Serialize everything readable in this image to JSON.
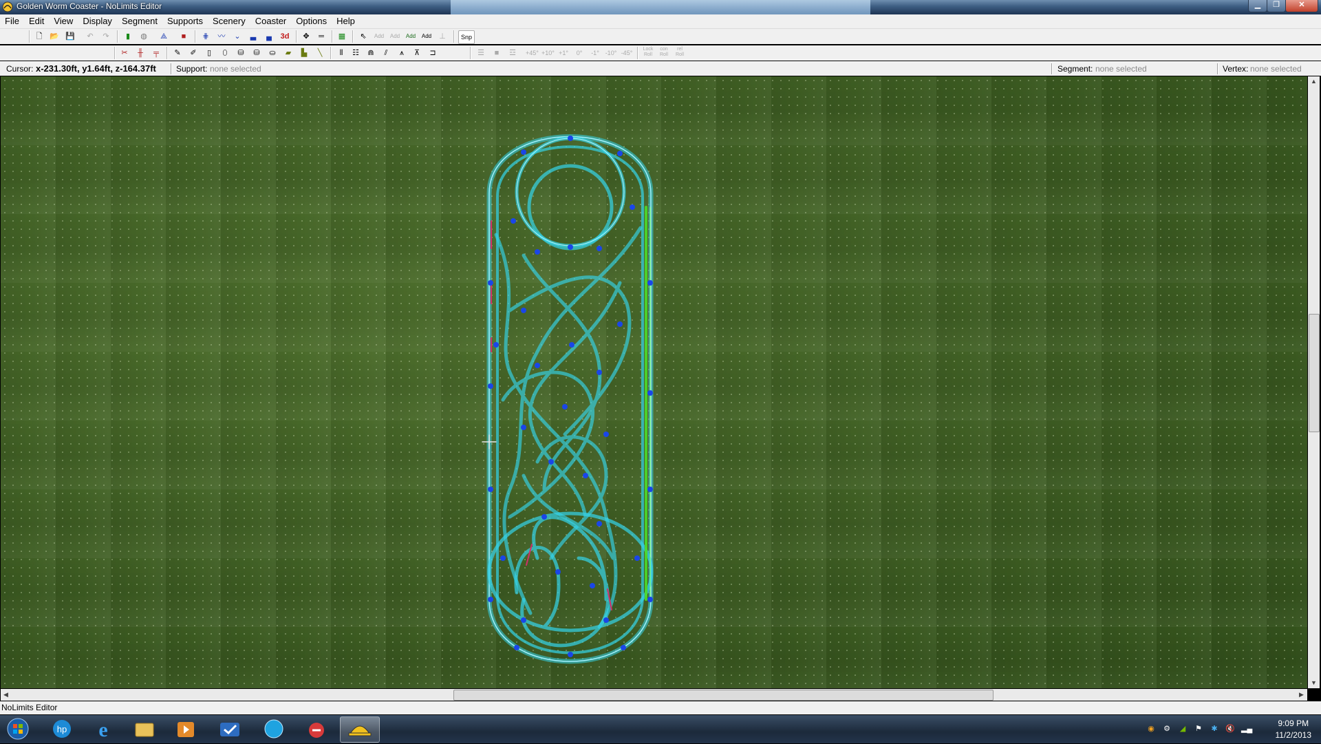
{
  "window": {
    "title": "Golden Worm Coaster - NoLimits Editor"
  },
  "menu": [
    "File",
    "Edit",
    "View",
    "Display",
    "Segment",
    "Supports",
    "Scenery",
    "Coaster",
    "Options",
    "Help"
  ],
  "toolbar": {
    "snap_label": "Snp",
    "add_labels": [
      "Add",
      "Add",
      "Add",
      "Add"
    ],
    "label_3d": "3d",
    "angle_labels": [
      "+45°",
      "+10°",
      "+1°",
      "0°",
      "-1°",
      "-10°",
      "-45°"
    ],
    "roll_labels": [
      "Lock Roll",
      "con Roll",
      "rel Roll"
    ]
  },
  "status": {
    "cursor_label": "Cursor:",
    "cursor_value": "x-231.30ft, y1.64ft, z-164.37ft",
    "support_label": "Support:",
    "support_value": "none selected",
    "segment_label": "Segment:",
    "segment_value": "none selected",
    "vertex_label": "Vertex:",
    "vertex_value": "none selected"
  },
  "app_status": "NoLimits Editor",
  "clock": {
    "time": "9:09 PM",
    "date": "11/2/2013"
  },
  "colors": {
    "track": "#35d4ea",
    "node": "#1a46e8",
    "highlight": "#4cdc2a",
    "support": "#d0306a"
  }
}
